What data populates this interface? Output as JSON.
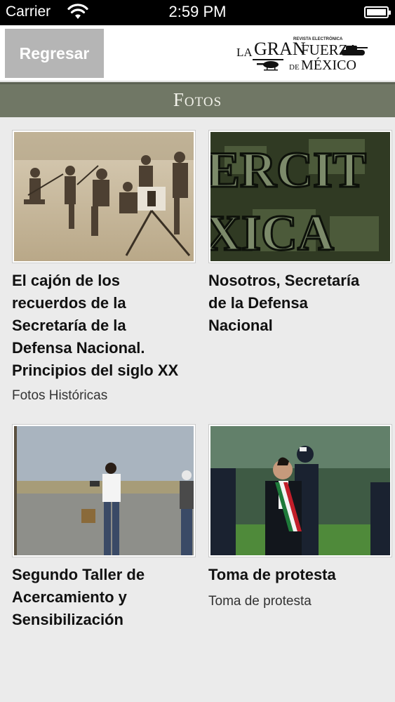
{
  "status_bar": {
    "carrier": "Carrier",
    "time": "2:59 PM"
  },
  "header": {
    "back_label": "Regresar",
    "logo": {
      "tag": "REVISTA ELECTRÓNICA",
      "la": "LA",
      "gran": "GRAN",
      "fuerza": "FUERZA",
      "de": "DE",
      "mexico": "MÉXICO"
    }
  },
  "section": {
    "title": "Fotos"
  },
  "cards": [
    {
      "title_lines": [
        "El cajón de los",
        "recuerdos de la",
        "Secretaría de la",
        "Defensa Nacional.",
        "Principios del siglo XX"
      ],
      "category": "Fotos Históricas"
    },
    {
      "title_lines": [
        "Nosotros, Secretaría",
        "de la Defensa",
        "Nacional"
      ],
      "category": ""
    },
    {
      "title_lines": [
        "Segundo Taller de",
        "Acercamiento y",
        "Sensibilización"
      ],
      "category": ""
    },
    {
      "title_lines": [
        "Toma de protesta"
      ],
      "category": "Toma de protesta"
    }
  ],
  "thumbnails": {
    "card1_letters": "ERCIT XICA"
  }
}
